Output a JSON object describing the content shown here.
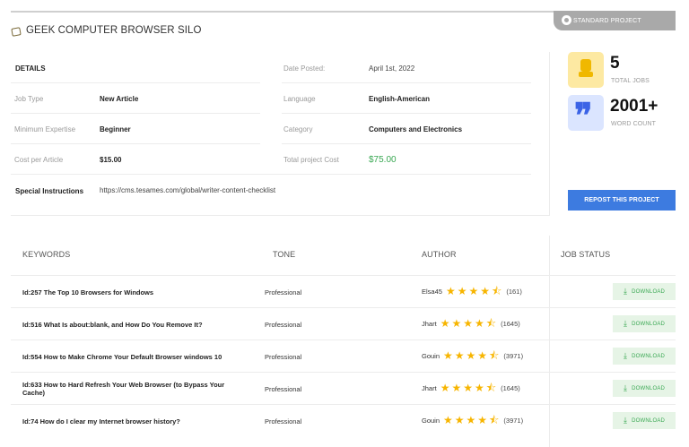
{
  "badge": {
    "label": "STANDARD PROJECT"
  },
  "project": {
    "title": "GEEK COMPUTER BROWSER SILO"
  },
  "details": {
    "heading": "DETAILS",
    "date_posted_label": "Date Posted:",
    "date_posted_value": "April 1st, 2022",
    "job_type_label": "Job Type",
    "job_type_value": "New Article",
    "language_label": "Language",
    "language_value": "English-American",
    "expertise_label": "Minimum Expertise",
    "expertise_value": "Beginner",
    "category_label": "Category",
    "category_value": "Computers and Electronics",
    "cost_article_label": "Cost per Article",
    "cost_article_value": "$15.00",
    "total_cost_label": "Total project Cost",
    "total_cost_value": "$75.00",
    "instructions_label": "Special Instructions",
    "instructions_value": "https://cms.tesames.com/global/writer-content-checklist"
  },
  "stats": {
    "jobs_value": "5",
    "jobs_label": "TOTAL JOBS",
    "words_value": "2001+",
    "words_label": "WORD COUNT"
  },
  "repost_label": "REPOST THIS PROJECT",
  "table": {
    "headers": {
      "keywords": "KEYWORDS",
      "tone": "TONE",
      "author": "AUTHOR",
      "status": "JOB STATUS"
    },
    "download_label": "DOWNLOAD",
    "rows": [
      {
        "keyword": "Id:257 The Top 10 Browsers for Windows",
        "tone": "Professional",
        "author": "Elsa45",
        "rating": 4.5,
        "count": "(161)"
      },
      {
        "keyword": "Id:516 What Is about:blank, and How Do You Remove It?",
        "tone": "Professional",
        "author": "Jhart",
        "rating": 4.5,
        "count": "(1645)"
      },
      {
        "keyword": "Id:554 How to Make Chrome Your Default Browser windows 10",
        "tone": "Professional",
        "author": "Gouin",
        "rating": 4.5,
        "count": "(3971)"
      },
      {
        "keyword": "Id:633 How to Hard Refresh Your Web Browser (to Bypass Your Cache)",
        "tone": "Professional",
        "author": "Jhart",
        "rating": 4.5,
        "count": "(1645)"
      },
      {
        "keyword": "Id:74 How do I clear my Internet browser history?",
        "tone": "Professional",
        "author": "Gouin",
        "rating": 4.5,
        "count": "(3971)"
      }
    ]
  }
}
